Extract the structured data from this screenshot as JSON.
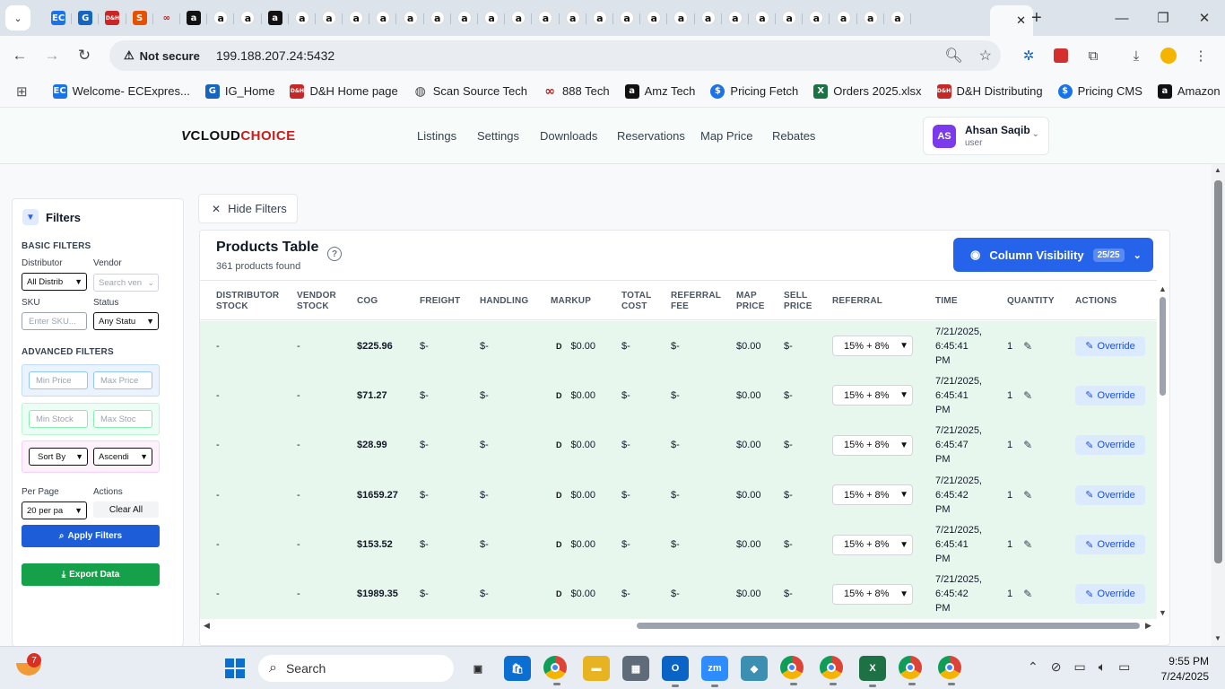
{
  "browser": {
    "tabs": [
      {
        "icon": "ec-icon",
        "color": "#1a73e8",
        "glyph": "EC",
        "style": "ec"
      },
      {
        "icon": "ig-icon",
        "color": "#1565c0",
        "glyph": "G",
        "style": "blue"
      },
      {
        "icon": "dh-icon",
        "color": "#c62828",
        "glyph": "D&H",
        "style": "red"
      },
      {
        "icon": "scansource-icon",
        "color": "#e65100",
        "glyph": "S",
        "style": "orange"
      },
      {
        "icon": "888-icon",
        "color": "#b71c1c",
        "glyph": "∞",
        "style": "ring"
      },
      {
        "icon": "amazon-icon",
        "color": "#111111",
        "glyph": "a",
        "style": "amzb"
      },
      {
        "icon": "amazon-icon",
        "color": "#111111",
        "glyph": "a",
        "style": "amz"
      },
      {
        "icon": "amazon-icon",
        "color": "#111111",
        "glyph": "a",
        "style": "amz"
      },
      {
        "icon": "amazon-icon",
        "color": "#111111",
        "glyph": "a",
        "style": "amzb"
      },
      {
        "icon": "amazon-icon",
        "color": "#111111",
        "glyph": "a",
        "style": "amz"
      },
      {
        "icon": "amazon-icon",
        "color": "#111111",
        "glyph": "a",
        "style": "amz"
      },
      {
        "icon": "amazon-icon",
        "color": "#111111",
        "glyph": "a",
        "style": "amz"
      },
      {
        "icon": "amazon-icon",
        "color": "#111111",
        "glyph": "a",
        "style": "amz"
      },
      {
        "icon": "amazon-icon",
        "color": "#111111",
        "glyph": "a",
        "style": "amz"
      },
      {
        "icon": "amazon-icon",
        "color": "#111111",
        "glyph": "a",
        "style": "amz"
      },
      {
        "icon": "amazon-icon",
        "color": "#111111",
        "glyph": "a",
        "style": "amz"
      },
      {
        "icon": "amazon-icon",
        "color": "#111111",
        "glyph": "a",
        "style": "amz"
      },
      {
        "icon": "amazon-icon",
        "color": "#111111",
        "glyph": "a",
        "style": "amz"
      },
      {
        "icon": "amazon-icon",
        "color": "#111111",
        "glyph": "a",
        "style": "amz"
      },
      {
        "icon": "amazon-icon",
        "color": "#111111",
        "glyph": "a",
        "style": "amz"
      },
      {
        "icon": "amazon-icon",
        "color": "#111111",
        "glyph": "a",
        "style": "amz"
      },
      {
        "icon": "amazon-icon",
        "color": "#111111",
        "glyph": "a",
        "style": "amz"
      },
      {
        "icon": "amazon-icon",
        "color": "#111111",
        "glyph": "a",
        "style": "amz"
      },
      {
        "icon": "amazon-icon",
        "color": "#111111",
        "glyph": "a",
        "style": "amz"
      },
      {
        "icon": "amazon-icon",
        "color": "#111111",
        "glyph": "a",
        "style": "amz"
      },
      {
        "icon": "amazon-icon",
        "color": "#111111",
        "glyph": "a",
        "style": "amz"
      },
      {
        "icon": "amazon-icon",
        "color": "#111111",
        "glyph": "a",
        "style": "amz"
      },
      {
        "icon": "amazon-icon",
        "color": "#111111",
        "glyph": "a",
        "style": "amz"
      },
      {
        "icon": "amazon-icon",
        "color": "#111111",
        "glyph": "a",
        "style": "amz"
      },
      {
        "icon": "amazon-icon",
        "color": "#111111",
        "glyph": "a",
        "style": "amz"
      },
      {
        "icon": "amazon-icon",
        "color": "#111111",
        "glyph": "a",
        "style": "amz"
      },
      {
        "icon": "amazon-icon",
        "color": "#111111",
        "glyph": "a",
        "style": "amz"
      }
    ],
    "security_label": "Not secure",
    "url": "199.188.207.24:5432",
    "bookmarks": [
      {
        "label": "Welcome- ECExpres...",
        "icon": "ec-icon",
        "glyph": "EC",
        "color": "#1a73e8"
      },
      {
        "label": "IG_Home",
        "icon": "ig-icon",
        "glyph": "G",
        "color": "#1565c0"
      },
      {
        "label": "D&H Home page",
        "icon": "dh-icon",
        "glyph": "D&H",
        "color": "#c62828"
      },
      {
        "label": "Scan Source Tech",
        "icon": "globe-icon",
        "glyph": "◍",
        "color": "#444444"
      },
      {
        "label": "888 Tech",
        "icon": "888-icon",
        "glyph": "∞",
        "color": "#b71c1c"
      },
      {
        "label": "Amz Tech",
        "icon": "amazon-icon",
        "glyph": "a",
        "color": "#111111"
      },
      {
        "label": "Pricing Fetch",
        "icon": "dollar-icon",
        "glyph": "$",
        "color": "#1a73e8"
      },
      {
        "label": "Orders 2025.xlsx",
        "icon": "excel-icon",
        "glyph": "X",
        "color": "#1e7145"
      },
      {
        "label": "D&H Distributing",
        "icon": "dh-icon",
        "glyph": "D&H",
        "color": "#c62828"
      },
      {
        "label": "Pricing CMS",
        "icon": "dollar-icon",
        "glyph": "$",
        "color": "#1a73e8"
      },
      {
        "label": "Amazon",
        "icon": "amazon-icon",
        "glyph": "a",
        "color": "#111111"
      }
    ]
  },
  "app": {
    "logo": {
      "v": "V",
      "cloud": "CLOUD",
      "choice": "CHOICE"
    },
    "nav": [
      "Listings",
      "Settings",
      "Downloads",
      "Reservations",
      "Map Price",
      "Rebates"
    ],
    "user": {
      "initials": "AS",
      "name": "Ahsan Saqib",
      "role": "user"
    }
  },
  "filters": {
    "title": "Filters",
    "basic_label": "BASIC FILTERS",
    "distributor_label": "Distributor",
    "distributor_value": "All Distrib",
    "vendor_label": "Vendor",
    "vendor_placeholder": "Search ven",
    "sku_label": "SKU",
    "sku_placeholder": "Enter SKU...",
    "status_label": "Status",
    "status_value": "Any Statu",
    "advanced_label": "ADVANCED FILTERS",
    "min_price": "Min Price",
    "max_price": "Max Price",
    "min_stock": "Min Stock",
    "max_stock": "Max Stoc",
    "sort_by": "Sort By",
    "sort_order": "Ascendi",
    "per_page_label": "Per Page",
    "per_page_value": "20 per pa",
    "actions_label": "Actions",
    "clear_all": "Clear All",
    "apply": "Apply Filters",
    "export": "Export Data"
  },
  "main": {
    "hide_filters": "Hide Filters",
    "table_title": "Products Table",
    "count_text": "361 products found",
    "column_visibility": "Column Visibility",
    "column_badge": "25/25",
    "columns": [
      {
        "label": "DISTRIBUTOR STOCK"
      },
      {
        "label": "VENDOR STOCK"
      },
      {
        "label": "COG"
      },
      {
        "label": "FREIGHT"
      },
      {
        "label": "HANDLING"
      },
      {
        "label": "MARKUP"
      },
      {
        "label": "TOTAL COST"
      },
      {
        "label": "REFERRAL FEE"
      },
      {
        "label": "MAP PRICE"
      },
      {
        "label": "SELL PRICE"
      },
      {
        "label": "REFERRAL"
      },
      {
        "label": "TIME"
      },
      {
        "label": "QUANTITY"
      },
      {
        "label": "ACTIONS"
      }
    ],
    "rows": [
      {
        "dist": "-",
        "vendor": "-",
        "cog": "$225.96",
        "freight": "$-",
        "handling": "$-",
        "markup_type": "D",
        "markup": "$0.00",
        "total": "$-",
        "fee": "$-",
        "map": "$0.00",
        "sell": "$-",
        "referral": "15% + 8%",
        "time": [
          "7/21/2025,",
          "6:45:41",
          "PM"
        ],
        "qty": "1",
        "action": "Override"
      },
      {
        "dist": "-",
        "vendor": "-",
        "cog": "$71.27",
        "freight": "$-",
        "handling": "$-",
        "markup_type": "D",
        "markup": "$0.00",
        "total": "$-",
        "fee": "$-",
        "map": "$0.00",
        "sell": "$-",
        "referral": "15% + 8%",
        "time": [
          "7/21/2025,",
          "6:45:41",
          "PM"
        ],
        "qty": "1",
        "action": "Override"
      },
      {
        "dist": "-",
        "vendor": "-",
        "cog": "$28.99",
        "freight": "$-",
        "handling": "$-",
        "markup_type": "D",
        "markup": "$0.00",
        "total": "$-",
        "fee": "$-",
        "map": "$0.00",
        "sell": "$-",
        "referral": "15% + 8%",
        "time": [
          "7/21/2025,",
          "6:45:47",
          "PM"
        ],
        "qty": "1",
        "action": "Override"
      },
      {
        "dist": "-",
        "vendor": "-",
        "cog": "$1659.27",
        "freight": "$-",
        "handling": "$-",
        "markup_type": "D",
        "markup": "$0.00",
        "total": "$-",
        "fee": "$-",
        "map": "$0.00",
        "sell": "$-",
        "referral": "15% + 8%",
        "time": [
          "7/21/2025,",
          "6:45:42",
          "PM"
        ],
        "qty": "1",
        "action": "Override"
      },
      {
        "dist": "-",
        "vendor": "-",
        "cog": "$153.52",
        "freight": "$-",
        "handling": "$-",
        "markup_type": "D",
        "markup": "$0.00",
        "total": "$-",
        "fee": "$-",
        "map": "$0.00",
        "sell": "$-",
        "referral": "15% + 8%",
        "time": [
          "7/21/2025,",
          "6:45:41",
          "PM"
        ],
        "qty": "1",
        "action": "Override"
      },
      {
        "dist": "-",
        "vendor": "-",
        "cog": "$1989.35",
        "freight": "$-",
        "handling": "$-",
        "markup_type": "D",
        "markup": "$0.00",
        "total": "$-",
        "fee": "$-",
        "map": "$0.00",
        "sell": "$-",
        "referral": "15% + 8%",
        "time": [
          "7/21/2025,",
          "6:45:42",
          "PM"
        ],
        "qty": "1",
        "action": "Override"
      }
    ]
  },
  "taskbar": {
    "search_label": "Search",
    "notification_count": "7",
    "time": "9:55 PM",
    "date": "7/24/2025",
    "apps": [
      {
        "icon": "task-view-icon",
        "glyph": "▣",
        "color": "#2b2b2b"
      },
      {
        "icon": "store-icon",
        "glyph": "🛍",
        "color": "#0a6fd1"
      },
      {
        "icon": "chrome-icon",
        "glyph": "◉",
        "color": "#db4437"
      },
      {
        "icon": "folder-icon",
        "glyph": "▬",
        "color": "#e8b323"
      },
      {
        "icon": "calculator-icon",
        "glyph": "▦",
        "color": "#5f6b78"
      },
      {
        "icon": "outlook-icon",
        "glyph": "O",
        "color": "#0a64c6"
      },
      {
        "icon": "zoom-icon",
        "glyph": "zm",
        "color": "#2d8cff"
      },
      {
        "icon": "app-diamond-icon",
        "glyph": "◆",
        "color": "#3b8fb0"
      },
      {
        "icon": "chrome-icon",
        "glyph": "◉",
        "color": "#db4437"
      },
      {
        "icon": "chrome-icon",
        "glyph": "◉",
        "color": "#db4437"
      },
      {
        "icon": "excel-icon",
        "glyph": "X",
        "color": "#1e7145"
      },
      {
        "icon": "chrome-icon",
        "glyph": "◉",
        "color": "#db4437"
      },
      {
        "icon": "chrome-icon",
        "glyph": "◉",
        "color": "#db4437"
      }
    ]
  }
}
